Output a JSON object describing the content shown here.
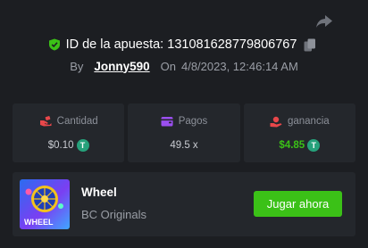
{
  "bet": {
    "id_label": "ID de la apuesta:",
    "id_value": "131081628779806767",
    "by_label": "By",
    "user": "Jonny590",
    "on_label": "On",
    "datetime": "4/8/2023, 12:46:14 AM"
  },
  "stats": [
    {
      "label": "Cantidad",
      "value": "$0.10",
      "icon": "bet-hand-icon",
      "value_color": "#c8cbd1",
      "coin": "T"
    },
    {
      "label": "Pagos",
      "value": "49.5 x",
      "icon": "wallet-icon",
      "value_color": "#c8cbd1"
    },
    {
      "label": "ganancia",
      "value": "$4.85",
      "icon": "profit-icon",
      "value_color": "#3bc117",
      "coin": "T"
    }
  ],
  "game": {
    "title": "Wheel",
    "provider": "BC Originals",
    "thumb_label": "WHEEL",
    "play_label": "Jugar ahora"
  },
  "colors": {
    "background": "#1c1e22",
    "card": "#24272c",
    "accent_green": "#3bc117",
    "muted": "#9a9ea6",
    "tether": "#26a17b"
  }
}
